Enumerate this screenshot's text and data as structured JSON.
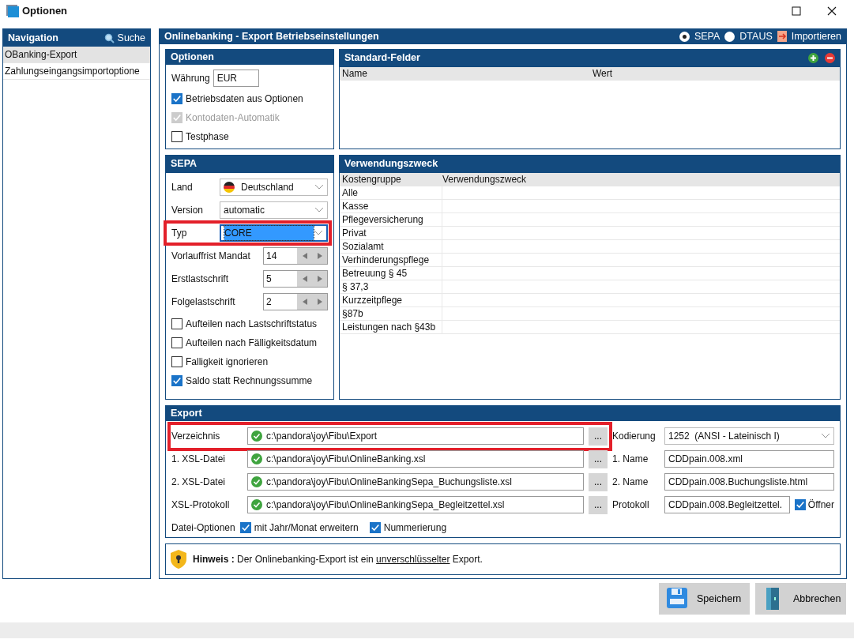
{
  "window": {
    "title": "Optionen"
  },
  "navigation": {
    "title": "Navigation",
    "search_label": "Suche",
    "items": [
      {
        "label": "OBanking-Export",
        "selected": true
      },
      {
        "label": "Zahlungseingangsimportoptione",
        "selected": false
      }
    ]
  },
  "main": {
    "title": "Onlinebanking - Export Betriebseinstellungen",
    "formats": [
      {
        "label": "SEPA",
        "selected": true
      },
      {
        "label": "DTAUS",
        "selected": false
      }
    ],
    "import_button": "Importieren"
  },
  "options": {
    "title": "Optionen",
    "currency_label": "Währung",
    "currency": "EUR",
    "checkboxes": [
      {
        "label": "Betriebsdaten aus Optionen",
        "checked": true,
        "disabled": false
      },
      {
        "label": "Kontodaten-Automatik",
        "checked": true,
        "disabled": true
      },
      {
        "label": "Testphase",
        "checked": false,
        "disabled": false
      }
    ]
  },
  "standard_fields": {
    "title": "Standard-Felder",
    "columns": [
      "Name",
      "Wert"
    ]
  },
  "sepa": {
    "title": "SEPA",
    "fields": [
      {
        "kind": "country",
        "label": "Land",
        "value": "Deutschland",
        "highlighted": false,
        "focused": false
      },
      {
        "kind": "select",
        "label": "Version",
        "value": "automatic",
        "highlighted": false,
        "focused": false
      },
      {
        "kind": "select",
        "label": "Typ",
        "value": "CORE",
        "highlighted": true,
        "focused": true
      },
      {
        "kind": "spin",
        "label": "Vorlauffrist Mandat",
        "value": "14",
        "highlighted": false,
        "focused": false
      },
      {
        "kind": "spin",
        "label": "Erstlastschrift",
        "value": "5",
        "highlighted": false,
        "focused": false
      },
      {
        "kind": "spin",
        "label": "Folgelastschrift",
        "value": "2",
        "highlighted": false,
        "focused": false
      }
    ],
    "checkboxes": [
      {
        "label": "Aufteilen nach Lastschriftstatus",
        "checked": false
      },
      {
        "label": "Aufteilen nach Fälligkeitsdatum",
        "checked": false
      },
      {
        "label": "Falligkeit ignorieren",
        "checked": false
      },
      {
        "label": "Saldo statt Rechnungssumme",
        "checked": true
      }
    ]
  },
  "purpose": {
    "title": "Verwendungszweck",
    "columns": [
      "Kostengruppe",
      "Verwendungszweck"
    ],
    "rows": [
      "Alle",
      "Kasse",
      "Pflegeversicherung",
      "Privat",
      "Sozialamt",
      "Verhinderungspflege",
      "Betreuung § 45",
      "§ 37,3",
      "Kurzzeitpflege",
      "§87b",
      "Leistungen nach §43b"
    ]
  },
  "export": {
    "title": "Export",
    "rows": [
      {
        "label": "Verzeichnis",
        "path": "c:\\pandora\\joy\\Fibu\\Export",
        "highlighted": true,
        "right_label": "Kodierung",
        "kind": "select",
        "right_value": "1252  (ANSI - Lateinisch I)"
      },
      {
        "label": "1. XSL-Datei",
        "path": "c:\\pandora\\joy\\Fibu\\OnlineBanking.xsl",
        "highlighted": false,
        "right_label": "1. Name",
        "kind": "text",
        "right_value": "CDDpain.008.xml"
      },
      {
        "label": "2. XSL-Datei",
        "path": "c:\\pandora\\joy\\Fibu\\OnlineBankingSepa_Buchungsliste.xsl",
        "highlighted": false,
        "right_label": "2. Name",
        "kind": "text",
        "right_value": "CDDpain.008.Buchungsliste.html"
      },
      {
        "label": "XSL-Protokoll",
        "path": "c:\\pandora\\joy\\Fibu\\OnlineBankingSepa_Begleitzettel.xsl",
        "highlighted": false,
        "right_label": "Protokoll",
        "kind": "text_check",
        "right_value": "CDDpain.008.Begleitzettel.",
        "check_label": "Öffner",
        "checked": true
      }
    ],
    "browse_label": "...",
    "file_options_label": "Datei-Optionen",
    "file_options": [
      {
        "label": "mit Jahr/Monat erweitern",
        "checked": true
      },
      {
        "label": "Nummerierung",
        "checked": true
      }
    ]
  },
  "notice": {
    "label": "Hinweis :",
    "text_start": "Der Onlinebanking-Export ist ein ",
    "text_underlined": "unverschlüsselter",
    "text_end": " Export."
  },
  "buttons": [
    {
      "label": "Speichern",
      "kind": "save"
    },
    {
      "label": "Abbrechen",
      "kind": "cancel"
    }
  ]
}
